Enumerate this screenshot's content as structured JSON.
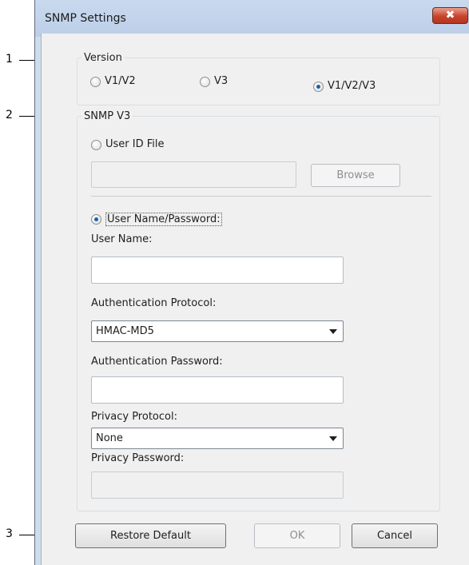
{
  "callouts": [
    "1",
    "2",
    "3"
  ],
  "window": {
    "title": "SNMP Settings",
    "close_label": "✖"
  },
  "version": {
    "label": "Version",
    "options": [
      {
        "label": "V1/V2",
        "checked": false
      },
      {
        "label": "V3",
        "checked": false
      },
      {
        "label": "V1/V2/V3",
        "checked": true
      }
    ]
  },
  "snmpv3": {
    "label": "SNMP V3",
    "user_id_file": {
      "label": "User ID File",
      "checked": false,
      "value": ""
    },
    "browse_label": "Browse",
    "user_name_password": {
      "label": "User Name/Password:",
      "checked": true
    },
    "user_name": {
      "label": "User Name:",
      "value": ""
    },
    "auth_protocol": {
      "label": "Authentication Protocol:",
      "value": "HMAC-MD5"
    },
    "auth_password": {
      "label": "Authentication Password:",
      "value": ""
    },
    "privacy_protocol": {
      "label": "Privacy Protocol:",
      "value": "None"
    },
    "privacy_password": {
      "label": "Privacy Password:",
      "value": ""
    }
  },
  "buttons": {
    "restore_default": "Restore Default",
    "ok": "OK",
    "cancel": "Cancel"
  }
}
